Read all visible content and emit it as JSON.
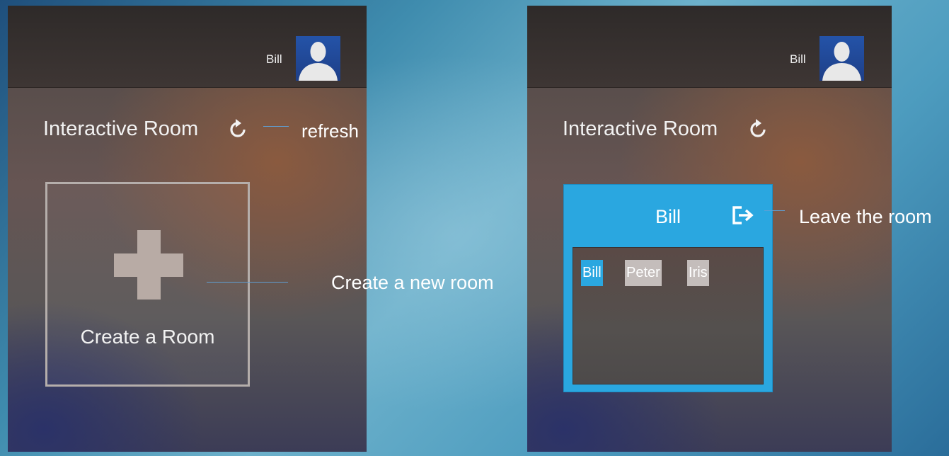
{
  "left_screen": {
    "user": {
      "name": "Bill"
    },
    "section_title": "Interactive Room",
    "create_room": {
      "label": "Create a Room"
    }
  },
  "right_screen": {
    "user": {
      "name": "Bill"
    },
    "section_title": "Interactive Room",
    "room": {
      "name": "Bill",
      "members": [
        {
          "name": "Bill",
          "is_self": true
        },
        {
          "name": "Peter",
          "is_self": false
        },
        {
          "name": "Iris",
          "is_self": false
        }
      ]
    }
  },
  "annotations": {
    "refresh": "refresh",
    "create_room": "Create a new room",
    "leave_room": "Leave the room"
  },
  "icons": {
    "refresh": "refresh-icon",
    "leave": "leave-room-icon",
    "plus": "plus-icon",
    "avatar": "user-avatar-icon"
  },
  "colors": {
    "accent": "#2aa7e0",
    "member_inactive": "#c4bdbb",
    "callout_line": "#5f9fd3"
  }
}
